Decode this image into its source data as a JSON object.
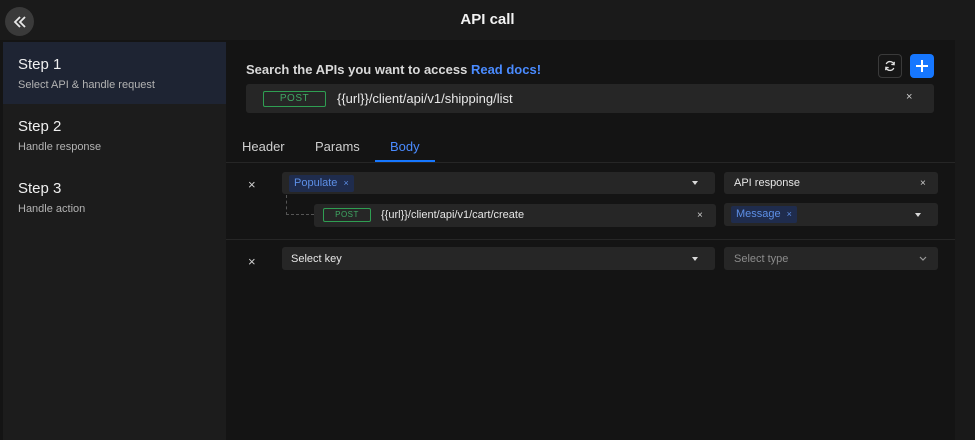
{
  "header": {
    "title": "API call",
    "back_icon": "double-chevron-left-icon"
  },
  "steps": [
    {
      "title": "Step 1",
      "subtitle": "Select API & handle request",
      "active": true
    },
    {
      "title": "Step 2",
      "subtitle": "Handle response",
      "active": false
    },
    {
      "title": "Step 3",
      "subtitle": "Handle action",
      "active": false
    }
  ],
  "search": {
    "label": "Search the APIs you want to access",
    "docs_link": "Read docs!",
    "method": "POST",
    "url": "{{url}}/client/api/v1/shipping/list",
    "clear": "×"
  },
  "tabs": [
    {
      "label": "Header",
      "active": false
    },
    {
      "label": "Params",
      "active": false
    },
    {
      "label": "Body",
      "active": true
    }
  ],
  "body_rows": {
    "row1": {
      "remove": "×",
      "key_tag": "Populate",
      "tag_remove": "×",
      "nested_method": "POST",
      "nested_url": "{{url}}/client/api/v1/cart/create",
      "nested_clear": "×",
      "type_value": "API response",
      "type_clear": "×",
      "field_tag": "Message",
      "field_tag_remove": "×"
    },
    "row2": {
      "remove": "×",
      "key_value": "Select key",
      "type_placeholder": "Select type"
    }
  },
  "colors": {
    "accent": "#1677ff",
    "method_green": "#3fa863",
    "tag_bg": "#1f2c4d"
  }
}
